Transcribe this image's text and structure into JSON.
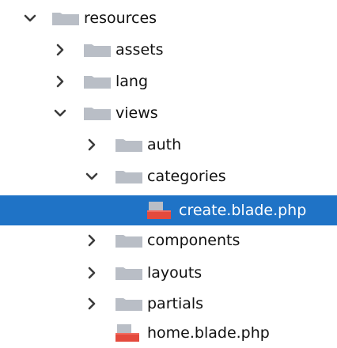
{
  "colors": {
    "selection_bg": "#1f73c6",
    "folder": "#b9bec6",
    "blade_icon_red": "#e44a3d"
  },
  "tree": [
    {
      "label": "resources",
      "state": "expanded",
      "icon": "folder-icon"
    },
    {
      "label": "assets",
      "state": "collapsed",
      "icon": "folder-icon"
    },
    {
      "label": "lang",
      "state": "collapsed",
      "icon": "folder-icon"
    },
    {
      "label": "views",
      "state": "expanded",
      "icon": "folder-icon"
    },
    {
      "label": "auth",
      "state": "collapsed",
      "icon": "folder-icon"
    },
    {
      "label": "categories",
      "state": "expanded",
      "icon": "folder-icon"
    },
    {
      "label": "create.blade.php",
      "state": "file",
      "icon": "blade-file-icon",
      "selected": true
    },
    {
      "label": "components",
      "state": "collapsed",
      "icon": "folder-icon"
    },
    {
      "label": "layouts",
      "state": "collapsed",
      "icon": "folder-icon"
    },
    {
      "label": "partials",
      "state": "collapsed",
      "icon": "folder-icon"
    },
    {
      "label": "home.blade.php",
      "state": "file",
      "icon": "blade-file-icon"
    }
  ]
}
